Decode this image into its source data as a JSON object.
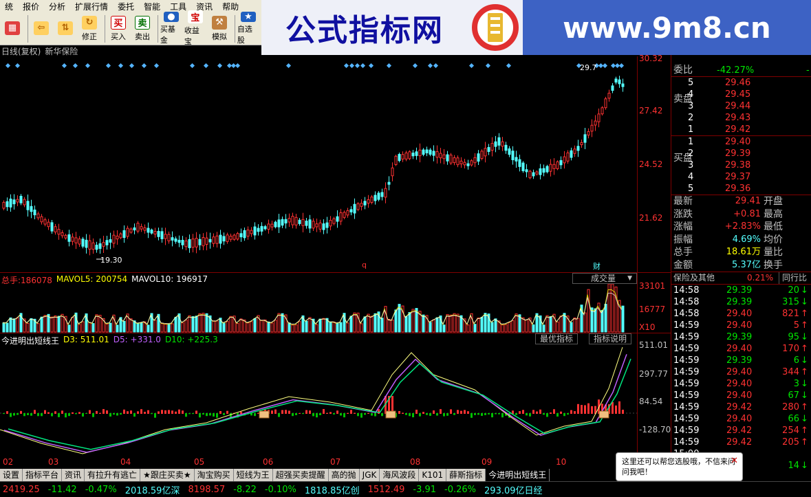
{
  "menu": [
    "统",
    "报价",
    "分析",
    "扩展行情",
    "委托",
    "智能",
    "工具",
    "资讯",
    "帮助"
  ],
  "toolbar": [
    {
      "label": "",
      "icon": "grid-icon"
    },
    {
      "label": "",
      "icon": "back-arrow-icon"
    },
    {
      "label": "",
      "icon": "up-down-arrows-icon"
    },
    {
      "label": "修正",
      "icon": "refresh-icon"
    },
    {
      "label": "买入",
      "icon": "buy-icon",
      "glyph": "买"
    },
    {
      "label": "卖出",
      "icon": "sell-icon",
      "glyph": "卖"
    },
    {
      "label": "买基金",
      "icon": "fund-icon"
    },
    {
      "label": "收益宝",
      "icon": "bao-icon",
      "glyph": "宝"
    },
    {
      "label": "模拟",
      "icon": "hammer-icon"
    },
    {
      "label": "自选股",
      "icon": "star-icon"
    }
  ],
  "banner": {
    "title": "公式指标网",
    "url": "www.9m8.cn",
    "logo_text": "9m8.cn"
  },
  "chart_header": {
    "mode": "日线(复权)",
    "stock": "新华保险"
  },
  "price_axis": [
    "30.32",
    "27.42",
    "24.52",
    "21.62"
  ],
  "price_labels": {
    "high": "29.7",
    "low": "19.30",
    "q": "q",
    "cai": "财"
  },
  "volume": {
    "label": "总手:",
    "value": "186078",
    "ma5_label": "MAVOL5:",
    "ma5": "200754",
    "ma10_label": "MAVOL10:",
    "ma10": "196917",
    "button": "成交量",
    "axis": [
      "33101",
      "16777"
    ],
    "unit": "X10"
  },
  "indicator": {
    "name": "今进明出短线王",
    "d3_label": "D3:",
    "d3": "511.01",
    "d5_label": "D5:",
    "d5": "+331.0",
    "d10_label": "D10:",
    "d10": "+225.3",
    "btn_best": "最优指标",
    "btn_help": "指标说明",
    "axis": [
      "511.01",
      "297.77",
      "84.54",
      "-128.70"
    ]
  },
  "date_axis": [
    "02",
    "03",
    "04",
    "05",
    "06",
    "07",
    "08",
    "09",
    "10"
  ],
  "tabs": [
    "设置",
    "指标平台",
    "资讯",
    "有拉升有逃亡",
    "★跟庄买卖★",
    "淘宝购买",
    "短线为王",
    "超强买卖提醒",
    "高的抛",
    "JGK",
    "海风波段",
    "K101",
    "薛斯指标",
    "今进明出短线王"
  ],
  "status": [
    {
      "text": "2419.25",
      "color": "red"
    },
    {
      "text": "-11.42",
      "color": "green"
    },
    {
      "text": "-0.47%",
      "color": "green"
    },
    {
      "text": "2018.59亿深",
      "color": "cyan"
    },
    {
      "text": "8198.57",
      "color": "red"
    },
    {
      "text": "-8.22",
      "color": "green"
    },
    {
      "text": "-0.10%",
      "color": "green"
    },
    {
      "text": "1818.85亿创",
      "color": "cyan"
    },
    {
      "text": "1512.49",
      "color": "red"
    },
    {
      "text": "-3.91",
      "color": "green"
    },
    {
      "text": "-0.26%",
      "color": "green"
    },
    {
      "text": "293.09亿日经",
      "color": "cyan"
    }
  ],
  "quote": {
    "weibi_label": "委比",
    "weibi": "-42.27%",
    "sell_label": "卖盘",
    "buy_label": "买盘",
    "sell": [
      {
        "lvl": "5",
        "price": "29.46"
      },
      {
        "lvl": "4",
        "price": "29.45"
      },
      {
        "lvl": "3",
        "price": "29.44"
      },
      {
        "lvl": "2",
        "price": "29.43"
      },
      {
        "lvl": "1",
        "price": "29.42"
      }
    ],
    "buy": [
      {
        "lvl": "1",
        "price": "29.40"
      },
      {
        "lvl": "2",
        "price": "29.39"
      },
      {
        "lvl": "3",
        "price": "29.38"
      },
      {
        "lvl": "4",
        "price": "29.37"
      },
      {
        "lvl": "5",
        "price": "29.36"
      }
    ],
    "stats": [
      {
        "l1": "最新",
        "v1": "29.41",
        "l2": "开盘",
        "c": "red"
      },
      {
        "l1": "涨跌",
        "v1": "+0.81",
        "l2": "最高",
        "c": "red"
      },
      {
        "l1": "涨幅",
        "v1": "+2.83%",
        "l2": "最低",
        "c": "red"
      },
      {
        "l1": "振幅",
        "v1": "4.69%",
        "l2": "均价",
        "c": "cyan"
      },
      {
        "l1": "总手",
        "v1": "18.61万",
        "l2": "量比",
        "c": "yellow"
      },
      {
        "l1": "金额",
        "v1": "5.37亿",
        "l2": "换手",
        "c": "cyan"
      }
    ],
    "sector_label": "保险及其他",
    "sector_pct": "0.21%",
    "peer_label": "同行比"
  },
  "ticks": [
    {
      "t": "14:58",
      "p": "29.39",
      "v": "20",
      "d": "down"
    },
    {
      "t": "14:58",
      "p": "29.39",
      "v": "315",
      "d": "down"
    },
    {
      "t": "14:58",
      "p": "29.40",
      "v": "821",
      "d": "up"
    },
    {
      "t": "14:59",
      "p": "29.40",
      "v": "5",
      "d": "up"
    },
    {
      "t": "14:59",
      "p": "29.39",
      "v": "95",
      "d": "down"
    },
    {
      "t": "14:59",
      "p": "29.40",
      "v": "170",
      "d": "up"
    },
    {
      "t": "14:59",
      "p": "29.39",
      "v": "6",
      "d": "down"
    },
    {
      "t": "14:59",
      "p": "29.40",
      "v": "344",
      "d": "up"
    },
    {
      "t": "14:59",
      "p": "29.40",
      "v": "3",
      "d": "down"
    },
    {
      "t": "14:59",
      "p": "29.40",
      "v": "67",
      "d": "down"
    },
    {
      "t": "14:59",
      "p": "29.42",
      "v": "280",
      "d": "up"
    },
    {
      "t": "14:59",
      "p": "29.40",
      "v": "66",
      "d": "down"
    },
    {
      "t": "14:59",
      "p": "29.42",
      "v": "254",
      "d": "up"
    },
    {
      "t": "14:59",
      "p": "29.42",
      "v": "205",
      "d": "up"
    },
    {
      "t": "15:00",
      "p": "",
      "v": "",
      "d": ""
    },
    {
      "t": "",
      "p": "",
      "v": "14",
      "d": "down"
    }
  ],
  "popup": {
    "text": "这里还可以帮您选股哦，不信来问问我吧！",
    "close": "✕"
  }
}
